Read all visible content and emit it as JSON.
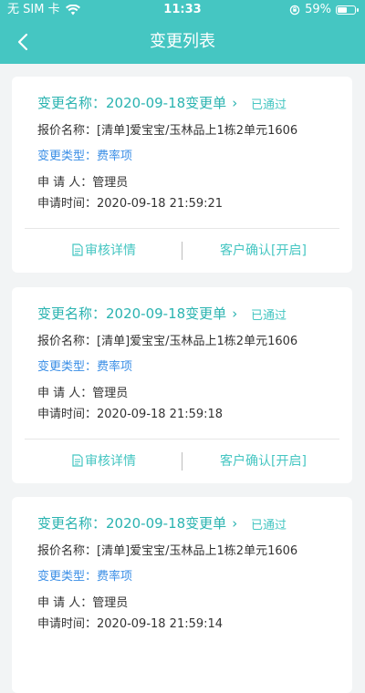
{
  "status_bar": {
    "carrier": "无 SIM 卡",
    "time": "11:33",
    "battery": "59%",
    "battery_level": 0.59
  },
  "header": {
    "title": "变更列表",
    "back_icon": "chevron-left-icon"
  },
  "cards": [
    {
      "name": "变更名称：2020-09-18变更单",
      "status": "已通过",
      "quote": "报价名称：[清单]爱宝宝/玉林品上1栋2单元1606",
      "type_label": "变更类型：",
      "type_value": "费率项",
      "applicant": "申 请 人：管理员",
      "time": "申请时间：2020-09-18 21:59:21",
      "detail_btn": "审核详情",
      "confirm_btn": "客户确认[开启]"
    },
    {
      "name": "变更名称：2020-09-18变更单",
      "status": "已通过",
      "quote": "报价名称：[清单]爱宝宝/玉林品上1栋2单元1606",
      "type_label": "变更类型：",
      "type_value": "费率项",
      "applicant": "申 请 人：管理员",
      "time": "申请时间：2020-09-18 21:59:18",
      "detail_btn": "审核详情",
      "confirm_btn": "客户确认[开启]"
    },
    {
      "name": "变更名称：2020-09-18变更单",
      "status": "已通过",
      "quote": "报价名称：[清单]爱宝宝/玉林品上1栋2单元1606",
      "type_label": "变更类型：",
      "type_value": "费率项",
      "applicant": "申 请 人：管理员",
      "time": "申请时间：2020-09-18 21:59:14",
      "detail_btn": "审核详情",
      "confirm_btn": "客户确认[开启]"
    }
  ]
}
